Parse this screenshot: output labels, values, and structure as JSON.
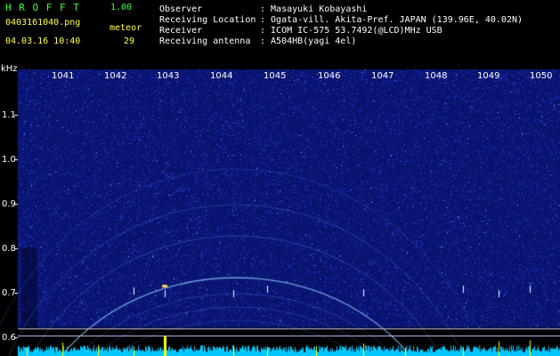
{
  "header": {
    "app_title": "H R O F F T",
    "version": "1.00",
    "filename": "0403161040.png",
    "timestamp": "04.03.16 10:40",
    "meteor_label": "meteor",
    "meteor_count": "29",
    "fields": [
      {
        "label": "Observer",
        "value": ": Masayuki Kobayashi"
      },
      {
        "label": "Receiving Location",
        "value": ": Ogata-vill. Akita-Pref. JAPAN (139.96E, 40.02N)"
      },
      {
        "label": "Receiver",
        "value": ": ICOM IC-575 53.7492(@LCD)MHz USB"
      },
      {
        "label": "Receiving antenna",
        "value": ": A504HB(yagi 4el)"
      }
    ]
  },
  "spectrogram": {
    "y_unit": "kHz",
    "y_ticks": [
      "1.1",
      "1.0",
      "0.9",
      "0.8",
      "0.7",
      "0.6"
    ],
    "x_ticks": [
      "1041",
      "1042",
      "1043",
      "1044",
      "1045",
      "1046",
      "1047",
      "1048",
      "1049",
      "1050"
    ],
    "colors": {
      "background": "#0a1470",
      "noise": "#2a4cff",
      "signal": "#8fd0ff",
      "bars": "#00c0ff",
      "peaks": "#ffff00"
    }
  }
}
